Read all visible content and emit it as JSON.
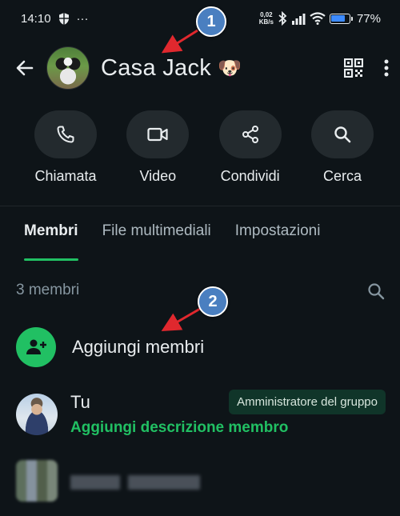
{
  "status_bar": {
    "time": "14:10",
    "more": "···",
    "net_speed_value": "0,02",
    "net_speed_unit": "KB/s",
    "battery_percent": "77%",
    "battery_level": 0.77
  },
  "header": {
    "title": "Casa Jack",
    "title_emoji": "🐶"
  },
  "actions": [
    {
      "label": "Chiamata",
      "icon": "phone-icon"
    },
    {
      "label": "Video",
      "icon": "video-icon"
    },
    {
      "label": "Condividi",
      "icon": "share-icon"
    },
    {
      "label": "Cerca",
      "icon": "search-icon"
    }
  ],
  "tabs": [
    {
      "label": "Membri",
      "active": true
    },
    {
      "label": "File multimediali",
      "active": false
    },
    {
      "label": "Impostazioni",
      "active": false
    }
  ],
  "members": {
    "count_label": "3 membri",
    "add_label": "Aggiungi membri",
    "me": {
      "name": "Tu",
      "description": "Aggiungi descrizione membro",
      "badge": "Amministratore del gruppo"
    }
  },
  "annotations": {
    "marker_1": "1",
    "marker_2": "2"
  },
  "colors": {
    "background": "#0e1418",
    "accent": "#21c063",
    "marker": "#4a7fc0",
    "arrow": "#e0282e"
  }
}
